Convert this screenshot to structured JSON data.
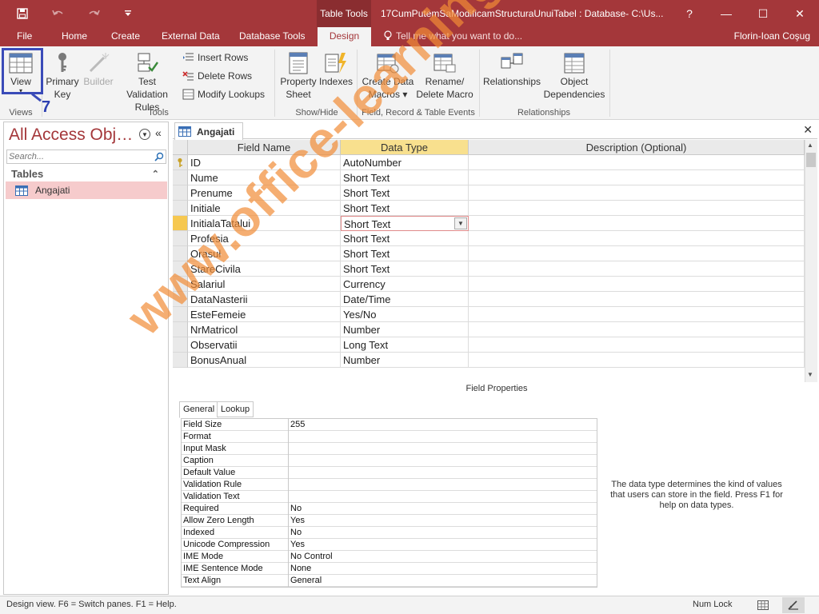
{
  "window": {
    "contextual_tab": "Table Tools",
    "title": "17CumPutemSaModificamStructuraUnuiTabel : Database- C:\\Us...",
    "help": "?",
    "minimize": "—",
    "maximize": "☐",
    "close": "✕"
  },
  "tabs": {
    "file": "File",
    "home": "Home",
    "create": "Create",
    "external": "External Data",
    "dbtools": "Database Tools",
    "design": "Design"
  },
  "tellme": "Tell me what you want to do...",
  "user": "Florin-Ioan Coşug",
  "ribbon": {
    "view": "View",
    "primary_key": [
      "Primary",
      "Key"
    ],
    "builder": "Builder",
    "test_validation": [
      "Test Validation",
      "Rules"
    ],
    "insert_rows": "Insert Rows",
    "delete_rows": "Delete Rows",
    "modify_lookups": "Modify Lookups",
    "property_sheet": [
      "Property",
      "Sheet"
    ],
    "indexes": "Indexes",
    "create_data_macros": [
      "Create Data",
      "Macros ▾"
    ],
    "rename_delete_macro": [
      "Rename/",
      "Delete Macro"
    ],
    "relationships": "Relationships",
    "object_dependencies": [
      "Object",
      "Dependencies"
    ],
    "groups": {
      "views": "Views",
      "tools": "Tools",
      "show_hide": "Show/Hide",
      "events": "Field, Record & Table Events",
      "relationships": "Relationships"
    }
  },
  "annotation_step": "7",
  "nav": {
    "title": "All Access Obje...",
    "search_placeholder": "Search...",
    "section": "Tables",
    "items": [
      "Angajati"
    ]
  },
  "document": {
    "tab": "Angajati",
    "close": "✕",
    "headers": {
      "field": "Field Name",
      "type": "Data Type",
      "desc": "Description (Optional)"
    },
    "fields": [
      {
        "name": "ID",
        "type": "AutoNumber"
      },
      {
        "name": "Nume",
        "type": "Short Text"
      },
      {
        "name": "Prenume",
        "type": "Short Text"
      },
      {
        "name": "Initiale",
        "type": "Short Text"
      },
      {
        "name": "InitialaTatalui",
        "type": "Short Text"
      },
      {
        "name": "Profesia",
        "type": "Short Text"
      },
      {
        "name": "Orasul",
        "type": "Short Text"
      },
      {
        "name": "StareCivila",
        "type": "Short Text"
      },
      {
        "name": "Salariul",
        "type": "Currency"
      },
      {
        "name": "DataNasterii",
        "type": "Date/Time"
      },
      {
        "name": "EsteFemeie",
        "type": "Yes/No"
      },
      {
        "name": "NrMatricol",
        "type": "Number"
      },
      {
        "name": "Observatii",
        "type": "Long Text"
      },
      {
        "name": "BonusAnual",
        "type": "Number"
      }
    ],
    "selected_row": 4,
    "field_properties_caption": "Field Properties",
    "prop_tabs": {
      "general": "General",
      "lookup": "Lookup"
    },
    "properties": [
      {
        "label": "Field Size",
        "value": "255"
      },
      {
        "label": "Format",
        "value": ""
      },
      {
        "label": "Input Mask",
        "value": ""
      },
      {
        "label": "Caption",
        "value": ""
      },
      {
        "label": "Default Value",
        "value": ""
      },
      {
        "label": "Validation Rule",
        "value": ""
      },
      {
        "label": "Validation Text",
        "value": ""
      },
      {
        "label": "Required",
        "value": "No"
      },
      {
        "label": "Allow Zero Length",
        "value": "Yes"
      },
      {
        "label": "Indexed",
        "value": "No"
      },
      {
        "label": "Unicode Compression",
        "value": "Yes"
      },
      {
        "label": "IME Mode",
        "value": "No Control"
      },
      {
        "label": "IME Sentence Mode",
        "value": "None"
      },
      {
        "label": "Text Align",
        "value": "General"
      }
    ],
    "help_text": "The data type determines the kind of values that users can store in the field. Press F1 for help on data types."
  },
  "watermark": "www.office-learning.ro",
  "status": {
    "text": "Design view.  F6 = Switch panes.  F1 = Help.",
    "numlock": "Num Lock"
  },
  "colors": {
    "accent": "#a4373a",
    "selection": "#f6cbcc",
    "highlight": "#3a4bb8",
    "watermark": "#f18c36"
  }
}
